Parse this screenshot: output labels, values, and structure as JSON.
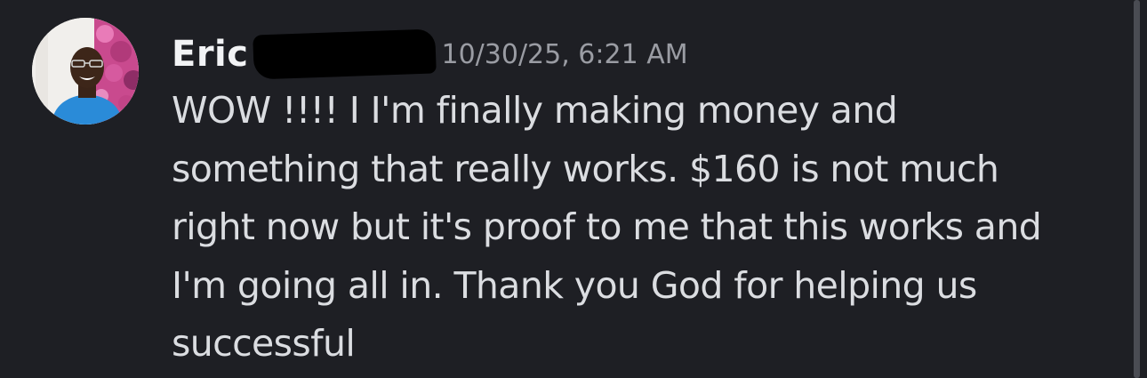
{
  "message": {
    "author": "Eric",
    "timestamp": "10/30/25, 6:21 AM",
    "content_lines": [
      "WOW !!!! I I'm finally making money and",
      "something that really works. $160 is not much",
      "right now but it's proof to me that this works and",
      "I'm going all in. Thank you God for helping us",
      "successful"
    ]
  },
  "colors": {
    "background": "#1e1f24",
    "username": "#f2f3f5",
    "timestamp": "#9a9ca3",
    "text": "#dbdde1",
    "scrollbar": "#4a4c53"
  }
}
